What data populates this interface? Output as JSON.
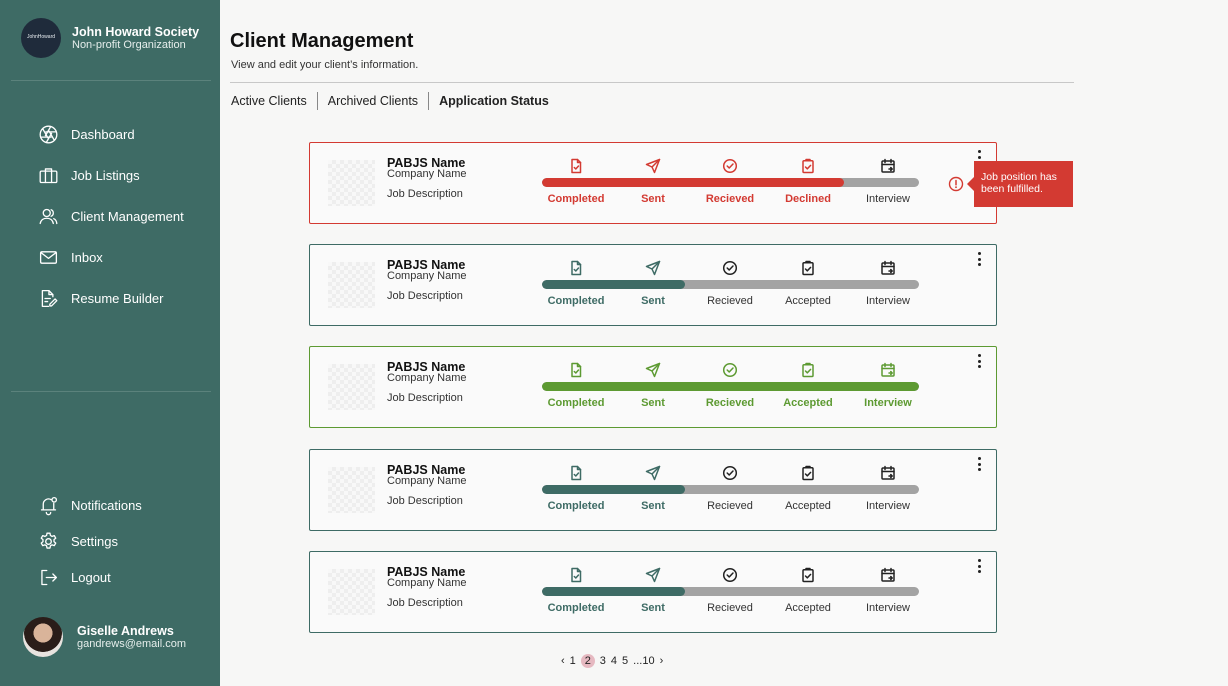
{
  "sidebar": {
    "org_logo_text": "JohnHoward",
    "org_name": "John Howard Society",
    "org_type": "Non-profit Organization",
    "nav": [
      {
        "label": "Dashboard",
        "icon": "aperture-icon"
      },
      {
        "label": "Job Listings",
        "icon": "briefcase-icon"
      },
      {
        "label": "Client Management",
        "icon": "users-icon"
      },
      {
        "label": "Inbox",
        "icon": "mail-icon"
      },
      {
        "label": "Resume Builder",
        "icon": "document-edit-icon"
      }
    ],
    "bottom_nav": [
      {
        "label": "Notifications",
        "icon": "bell-icon"
      },
      {
        "label": "Settings",
        "icon": "gear-icon"
      },
      {
        "label": "Logout",
        "icon": "logout-icon"
      }
    ],
    "user": {
      "name": "Giselle Andrews",
      "email": "gandrews@email.com"
    }
  },
  "header": {
    "title": "Client Management",
    "subtitle": "View and edit your client’s information."
  },
  "tabs": [
    {
      "label": "Active Clients",
      "active": false
    },
    {
      "label": "Archived Clients",
      "active": false
    },
    {
      "label": "Application Status",
      "active": true
    }
  ],
  "colors": {
    "red": "#d33a32",
    "teal": "#3e6b65",
    "green": "#5d9a32",
    "gray": "#a3a3a3"
  },
  "cards": [
    {
      "name": "PABJS Name",
      "company": "Company Name",
      "description": "Job Description",
      "theme": "red",
      "progress": 0.8,
      "steps": [
        {
          "label": "Completed",
          "state": "active"
        },
        {
          "label": "Sent",
          "state": "active"
        },
        {
          "label": "Recieved",
          "state": "active"
        },
        {
          "label": "Declined",
          "state": "active"
        },
        {
          "label": "Interview",
          "state": "inactive"
        }
      ],
      "tooltip": "Job position has been fulfilled."
    },
    {
      "name": "PABJS Name",
      "company": "Company Name",
      "description": "Job Description",
      "theme": "teal",
      "progress": 0.38,
      "steps": [
        {
          "label": "Completed",
          "state": "active"
        },
        {
          "label": "Sent",
          "state": "active"
        },
        {
          "label": "Recieved",
          "state": "inactive"
        },
        {
          "label": "Accepted",
          "state": "inactive"
        },
        {
          "label": "Interview",
          "state": "inactive"
        }
      ]
    },
    {
      "name": "PABJS Name",
      "company": "Company Name",
      "description": "Job Description",
      "theme": "green",
      "progress": 1.0,
      "steps": [
        {
          "label": "Completed",
          "state": "active"
        },
        {
          "label": "Sent",
          "state": "active"
        },
        {
          "label": "Recieved",
          "state": "active"
        },
        {
          "label": "Accepted",
          "state": "active"
        },
        {
          "label": "Interview",
          "state": "active"
        }
      ]
    },
    {
      "name": "PABJS Name",
      "company": "Company Name",
      "description": "Job Description",
      "theme": "teal",
      "progress": 0.38,
      "steps": [
        {
          "label": "Completed",
          "state": "active"
        },
        {
          "label": "Sent",
          "state": "active"
        },
        {
          "label": "Recieved",
          "state": "inactive"
        },
        {
          "label": "Accepted",
          "state": "inactive"
        },
        {
          "label": "Interview",
          "state": "inactive"
        }
      ]
    },
    {
      "name": "PABJS Name",
      "company": "Company Name",
      "description": "Job Description",
      "theme": "teal",
      "progress": 0.38,
      "steps": [
        {
          "label": "Completed",
          "state": "active"
        },
        {
          "label": "Sent",
          "state": "active"
        },
        {
          "label": "Recieved",
          "state": "inactive"
        },
        {
          "label": "Accepted",
          "state": "inactive"
        },
        {
          "label": "Interview",
          "state": "inactive"
        }
      ]
    }
  ],
  "pagination": {
    "prev_icon": "chevron-left-icon",
    "pages": [
      "1",
      "2",
      "3",
      "4",
      "5",
      "...10"
    ],
    "current": "2",
    "next_icon": "chevron-right-icon"
  }
}
